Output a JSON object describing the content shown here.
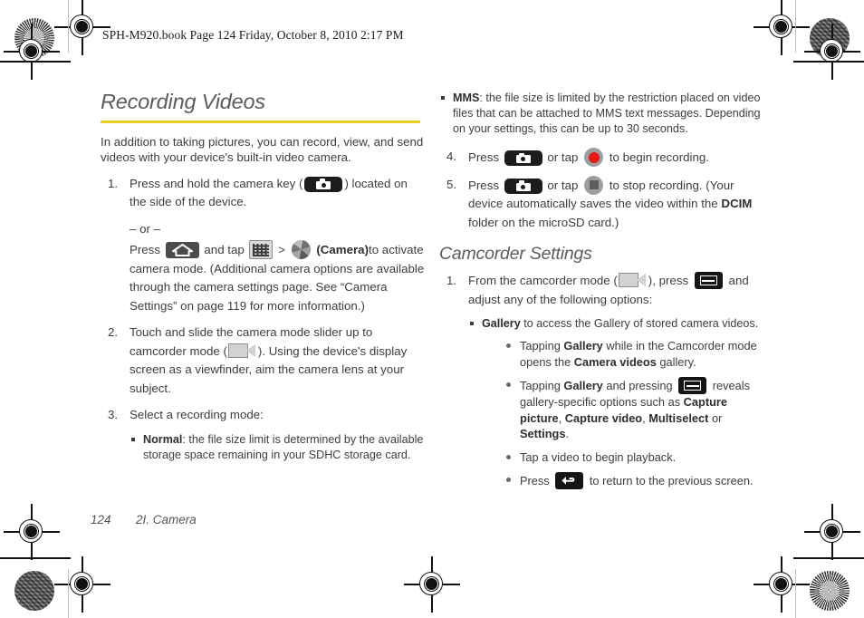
{
  "header": {
    "running_text": "SPH-M920.book  Page 124  Friday, October 8, 2010  2:17 PM"
  },
  "left_column": {
    "title": "Recording Videos",
    "intro": "In addition to taking pictures, you can record, view, and send videos with your device's built-in video camera.",
    "steps": [
      {
        "number": "1.",
        "text_before_icon": "Press and hold the camera key (",
        "icon": "camera-key-icon",
        "text_after_icon": ") located on the side of the device.",
        "or_label": "– or –",
        "alt_press_label": "Press",
        "alt_icon_1": "home-key-icon",
        "alt_and_tap_label": "and tap",
        "alt_icon_2": "apps-grid-icon",
        "alt_separator": ">",
        "alt_icon_3": "camera-shutter-icon",
        "alt_app_name": "(Camera)",
        "alt_tail": "to activate camera mode. (Additional camera options are available through the camera settings page. See “Camera Settings” on page 119 for more information.)"
      },
      {
        "number": "2.",
        "text_before_icon": "Touch and slide the camera mode slider up to camcorder mode (",
        "icon": "camcorder-slider-icon",
        "text_after_icon": "). Using the device's display screen as a viewfinder, aim the camera lens at your subject."
      },
      {
        "number": "3.",
        "text_before_icon": "Select a recording mode:"
      }
    ],
    "mode_bullets": [
      {
        "term": "Normal",
        "text": ": the file size limit is determined by the available storage space remaining in your SDHC storage card."
      }
    ]
  },
  "right_column": {
    "mms_bullet": {
      "term": "MMS",
      "text": ": the file size is limited by the restriction placed on video files that can be attached to MMS text messages. Depending on your settings, this can be up to 30 seconds."
    },
    "steps": [
      {
        "number": "4.",
        "press_label": "Press",
        "icon_key": "camera-key-icon",
        "or_tap_label": "or tap",
        "icon_soft": "record-button-icon",
        "tail": "to begin recording."
      },
      {
        "number": "5.",
        "press_label": "Press",
        "icon_key": "camera-key-icon",
        "or_tap_label": "or tap",
        "icon_soft": "stop-button-icon",
        "tail_part1": "to stop recording. (Your device automatically saves the video within the",
        "tail_bold": "DCIM",
        "tail_part2": "folder on the microSD card.)"
      }
    ],
    "subsection_title": "Camcorder Settings",
    "settings_step": {
      "number": "1.",
      "text_before_slider": "From the camcorder mode (",
      "slider_icon": "camcorder-slider-icon",
      "text_mid": "), press",
      "menu_icon": "menu-key-icon",
      "text_after": "and adjust any of the following options:"
    },
    "gallery_bullet": {
      "term": "Gallery",
      "text": " to access the Gallery of stored camera videos."
    },
    "gallery_sub_bullets": [
      {
        "part1": "Tapping ",
        "bold1": "Gallery",
        "part2": " while in the Camcorder mode opens the ",
        "bold2": "Camera videos",
        "part3": " gallery."
      },
      {
        "part1": "Tapping ",
        "bold1": "Gallery",
        "part2": " and pressing ",
        "icon": "menu-key-icon",
        "part3": " reveals gallery-specific options such as ",
        "bold2": "Capture picture",
        "sep1": ", ",
        "bold3": "Capture video",
        "sep2": ", ",
        "bold4": "Multiselect",
        "sep3": " or ",
        "bold5": "Settings",
        "part4": "."
      },
      {
        "plain": "Tap a video to begin playback."
      },
      {
        "part1": "Press ",
        "icon": "back-key-icon",
        "part3": " to return to the previous screen."
      }
    ]
  },
  "footer": {
    "page_number": "124",
    "chapter": "2I. Camera"
  },
  "colors": {
    "rule": "#E8CE1E",
    "heading": "#5C5C5C",
    "body": "#3D3D3D",
    "record_red": "#E8191B",
    "key_black": "#1C1C1C"
  }
}
